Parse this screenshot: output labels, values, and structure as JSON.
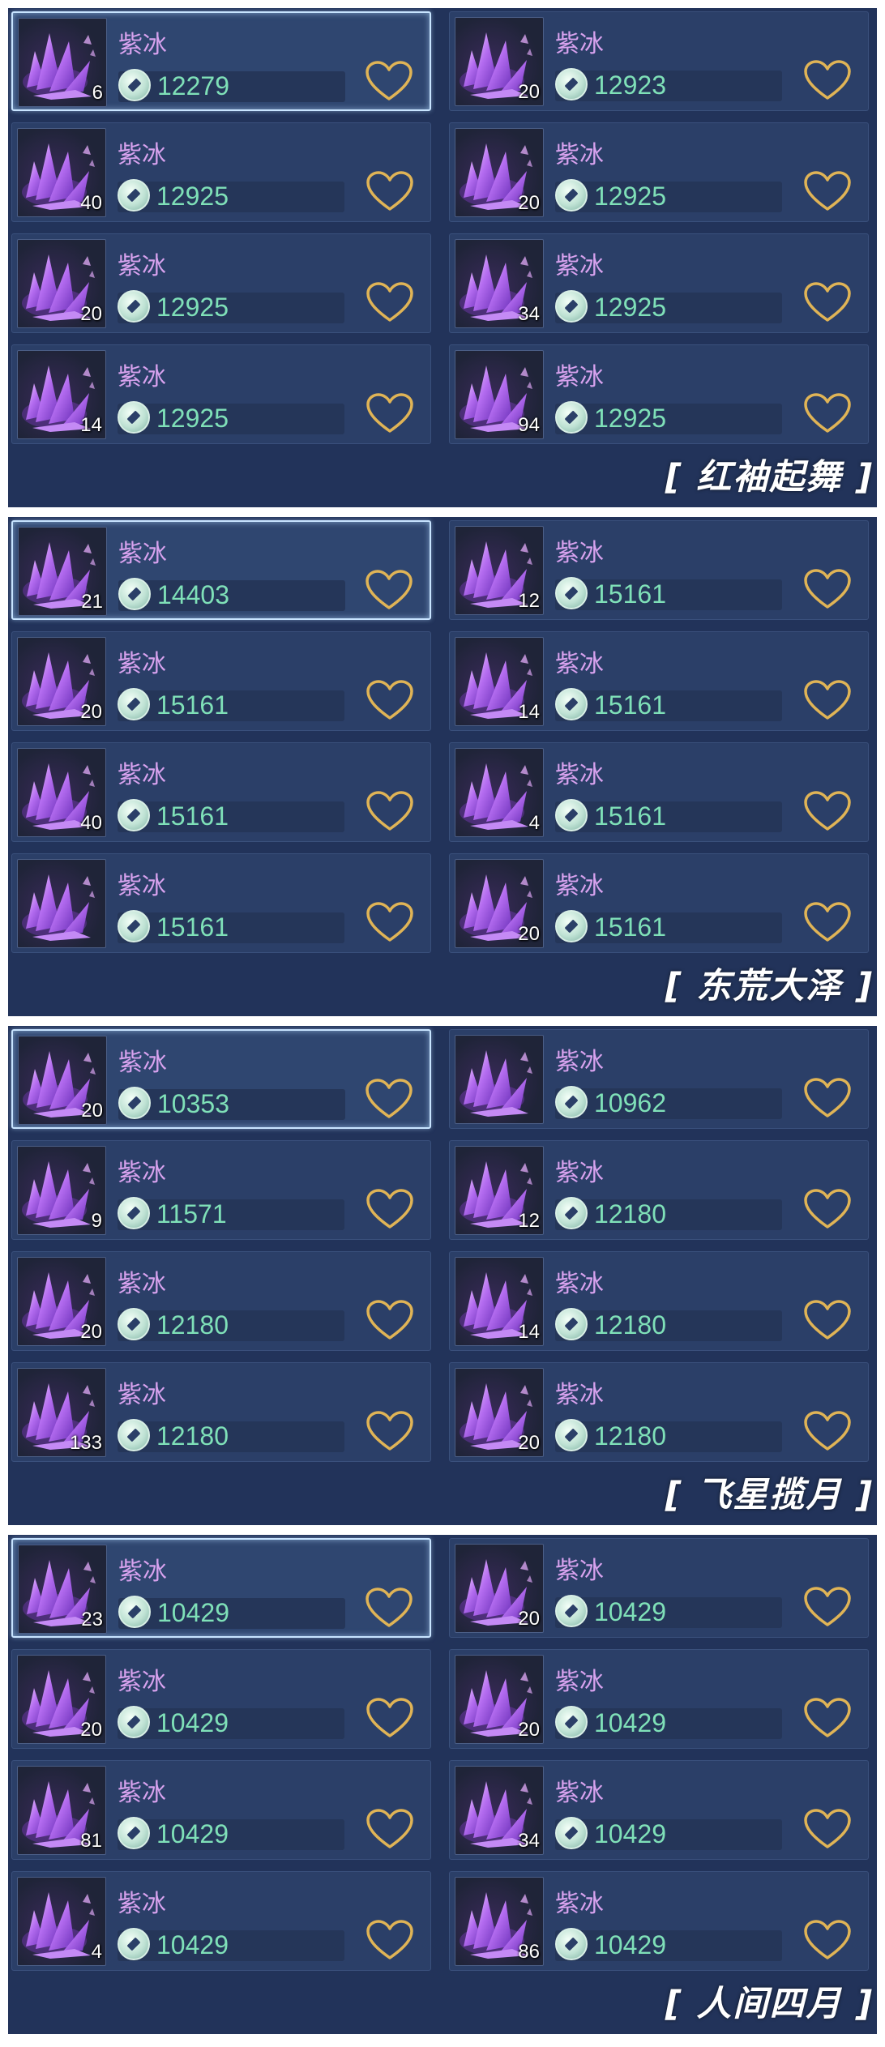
{
  "icons": {
    "favorite": "heart-outline-icon",
    "currency": "jade-coin-icon",
    "item": "purple-crystal-icon"
  },
  "colors": {
    "panel_bg": "#22335a",
    "item_name": "#d7a2ee",
    "price": "#7fe0b8",
    "heart": "#e0b456"
  },
  "sections": [
    {
      "title": "[ 红袖起舞 ]",
      "items": [
        {
          "name": "紫冰",
          "qty": "6",
          "price": "12279",
          "selected": true
        },
        {
          "name": "紫冰",
          "qty": "20",
          "price": "12923"
        },
        {
          "name": "紫冰",
          "qty": "40",
          "price": "12925"
        },
        {
          "name": "紫冰",
          "qty": "20",
          "price": "12925"
        },
        {
          "name": "紫冰",
          "qty": "20",
          "price": "12925"
        },
        {
          "name": "紫冰",
          "qty": "34",
          "price": "12925"
        },
        {
          "name": "紫冰",
          "qty": "14",
          "price": "12925"
        },
        {
          "name": "紫冰",
          "qty": "94",
          "price": "12925"
        }
      ]
    },
    {
      "title": "[ 东荒大泽 ]",
      "items": [
        {
          "name": "紫冰",
          "qty": "21",
          "price": "14403",
          "selected": true
        },
        {
          "name": "紫冰",
          "qty": "12",
          "price": "15161"
        },
        {
          "name": "紫冰",
          "qty": "20",
          "price": "15161"
        },
        {
          "name": "紫冰",
          "qty": "14",
          "price": "15161"
        },
        {
          "name": "紫冰",
          "qty": "40",
          "price": "15161"
        },
        {
          "name": "紫冰",
          "qty": "4",
          "price": "15161"
        },
        {
          "name": "紫冰",
          "qty": "",
          "price": "15161"
        },
        {
          "name": "紫冰",
          "qty": "20",
          "price": "15161"
        }
      ]
    },
    {
      "title": "[ 飞星揽月 ]",
      "items": [
        {
          "name": "紫冰",
          "qty": "20",
          "price": "10353",
          "selected": true
        },
        {
          "name": "紫冰",
          "qty": "",
          "price": "10962"
        },
        {
          "name": "紫冰",
          "qty": "9",
          "price": "11571"
        },
        {
          "name": "紫冰",
          "qty": "12",
          "price": "12180"
        },
        {
          "name": "紫冰",
          "qty": "20",
          "price": "12180"
        },
        {
          "name": "紫冰",
          "qty": "14",
          "price": "12180"
        },
        {
          "name": "紫冰",
          "qty": "133",
          "price": "12180"
        },
        {
          "name": "紫冰",
          "qty": "20",
          "price": "12180"
        }
      ]
    },
    {
      "title": "[ 人间四月 ]",
      "items": [
        {
          "name": "紫冰",
          "qty": "23",
          "price": "10429",
          "selected": true
        },
        {
          "name": "紫冰",
          "qty": "20",
          "price": "10429"
        },
        {
          "name": "紫冰",
          "qty": "20",
          "price": "10429"
        },
        {
          "name": "紫冰",
          "qty": "20",
          "price": "10429"
        },
        {
          "name": "紫冰",
          "qty": "81",
          "price": "10429"
        },
        {
          "name": "紫冰",
          "qty": "34",
          "price": "10429"
        },
        {
          "name": "紫冰",
          "qty": "4",
          "price": "10429"
        },
        {
          "name": "紫冰",
          "qty": "86",
          "price": "10429"
        }
      ]
    }
  ]
}
